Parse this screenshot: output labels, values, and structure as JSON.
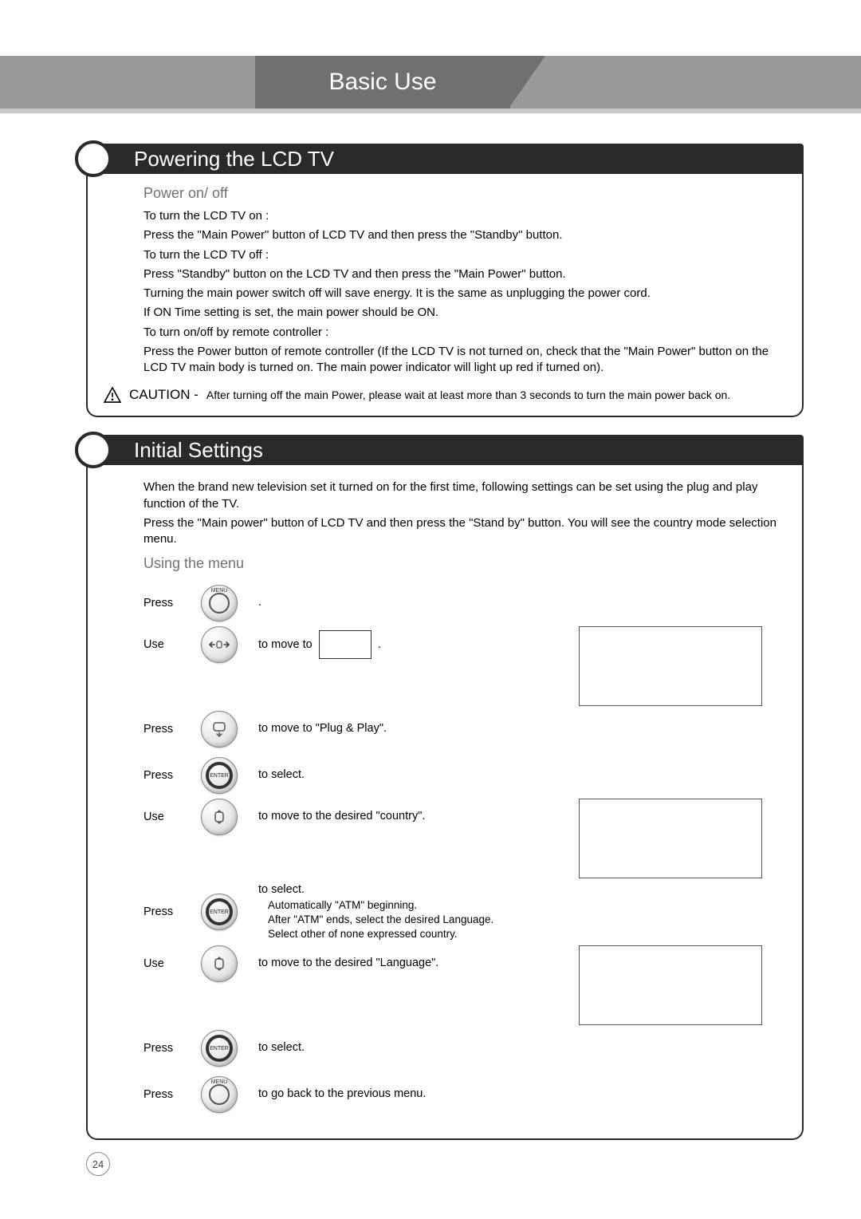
{
  "page": {
    "tab_title": "Basic Use",
    "number": "24"
  },
  "section1": {
    "title": "Powering the LCD TV",
    "subhead": "Power on/ off",
    "lines": [
      "To turn the LCD TV on :",
      "Press the \"Main Power\" button of LCD TV and then press the \"Standby\" button.",
      "To turn the LCD TV off :",
      "Press \"Standby\" button on the LCD TV and then press the \"Main Power\" button.",
      "Turning the main power switch off will save energy. It is the same as unplugging the power cord.",
      "If ON Time setting is set, the main power should be ON.",
      "To turn on/off by remote controller :",
      "Press the Power button of remote controller (If the LCD TV is not turned on, check that the \"Main Power\" button on the LCD TV main body is turned on. The main power indicator will light up red if turned on)."
    ],
    "caution_label": "CAUTION -",
    "caution_text": "After turning off the main Power, please wait at least more than 3 seconds to turn the main power back on."
  },
  "section2": {
    "title": "Initial Settings",
    "intro": [
      "When the brand new television set it turned on for the first time, following settings can be set using the plug and play function of the TV.",
      "Press the \"Main power\" button of LCD TV and then press the \"Stand by\" button. You will see the country mode selection menu."
    ],
    "subhead": "Using the menu",
    "steps": [
      {
        "verb": "Press",
        "icon": "menu",
        "text_parts": [
          "."
        ],
        "box": false
      },
      {
        "verb": "Use",
        "icon": "lr",
        "text_parts": [
          "to move to",
          "BOX",
          "."
        ],
        "box": false
      },
      {
        "verb": "Press",
        "icon": "down",
        "text_parts": [
          "to move to  \"Plug & Play\"."
        ],
        "box": "span-prev"
      },
      {
        "verb": "Press",
        "icon": "enter",
        "text_parts": [
          "to select."
        ],
        "box": false
      },
      {
        "verb": "Use",
        "icon": "updown",
        "text_parts": [
          "to move to the desired \"country\"."
        ],
        "box": true
      },
      {
        "verb": "Press",
        "icon": "enter",
        "text_parts": [
          "to select.",
          "SUB:Automatically \"ATM\" beginning.",
          "SUB:After \"ATM\" ends, select the desired Language.",
          "SUB:Select other of none expressed country."
        ],
        "box": "span-prev"
      },
      {
        "verb": "Use",
        "icon": "updown",
        "text_parts": [
          "to move to the desired \"Language\"."
        ],
        "box": true
      },
      {
        "verb": "Press",
        "icon": "enter",
        "text_parts": [
          "to select."
        ],
        "box": "span-prev"
      },
      {
        "verb": "Press",
        "icon": "menu",
        "text_parts": [
          "to go back to the previous menu."
        ],
        "box": false
      }
    ],
    "icon_labels": {
      "menu": "MENU",
      "enter": "ENTER"
    }
  }
}
